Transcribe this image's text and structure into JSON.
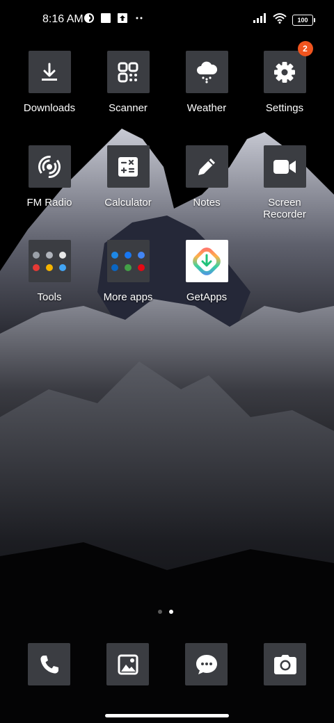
{
  "status_bar": {
    "time": "8:16 AM",
    "battery": "100",
    "icons": [
      "vpn-icon",
      "square-notification-icon",
      "upload-notification-icon",
      "more-notifications-icon",
      "signal-icon",
      "wifi-icon",
      "battery-icon"
    ]
  },
  "apps": [
    {
      "label": "Downloads",
      "icon": "download-icon"
    },
    {
      "label": "Scanner",
      "icon": "qr-scanner-icon"
    },
    {
      "label": "Weather",
      "icon": "cloud-rain-icon"
    },
    {
      "label": "Settings",
      "icon": "gear-icon",
      "badge": "2"
    },
    {
      "label": "FM Radio",
      "icon": "radio-broadcast-icon"
    },
    {
      "label": "Calculator",
      "icon": "calculator-icon"
    },
    {
      "label": "Notes",
      "icon": "pencil-icon"
    },
    {
      "label": "Screen Recorder",
      "icon": "video-camera-icon"
    },
    {
      "label": "Tools",
      "icon": "folder-icon"
    },
    {
      "label": "More apps",
      "icon": "folder-icon"
    },
    {
      "label": "GetApps",
      "icon": "getapps-icon"
    }
  ],
  "dock": [
    {
      "icon": "phone-icon"
    },
    {
      "icon": "gallery-icon"
    },
    {
      "icon": "messages-icon"
    },
    {
      "icon": "camera-icon"
    }
  ],
  "page_indicator": {
    "pages": 2,
    "active": 2
  },
  "colors": {
    "tile": "#3b3d42",
    "badge": "#f0541e",
    "background": "#000000"
  }
}
